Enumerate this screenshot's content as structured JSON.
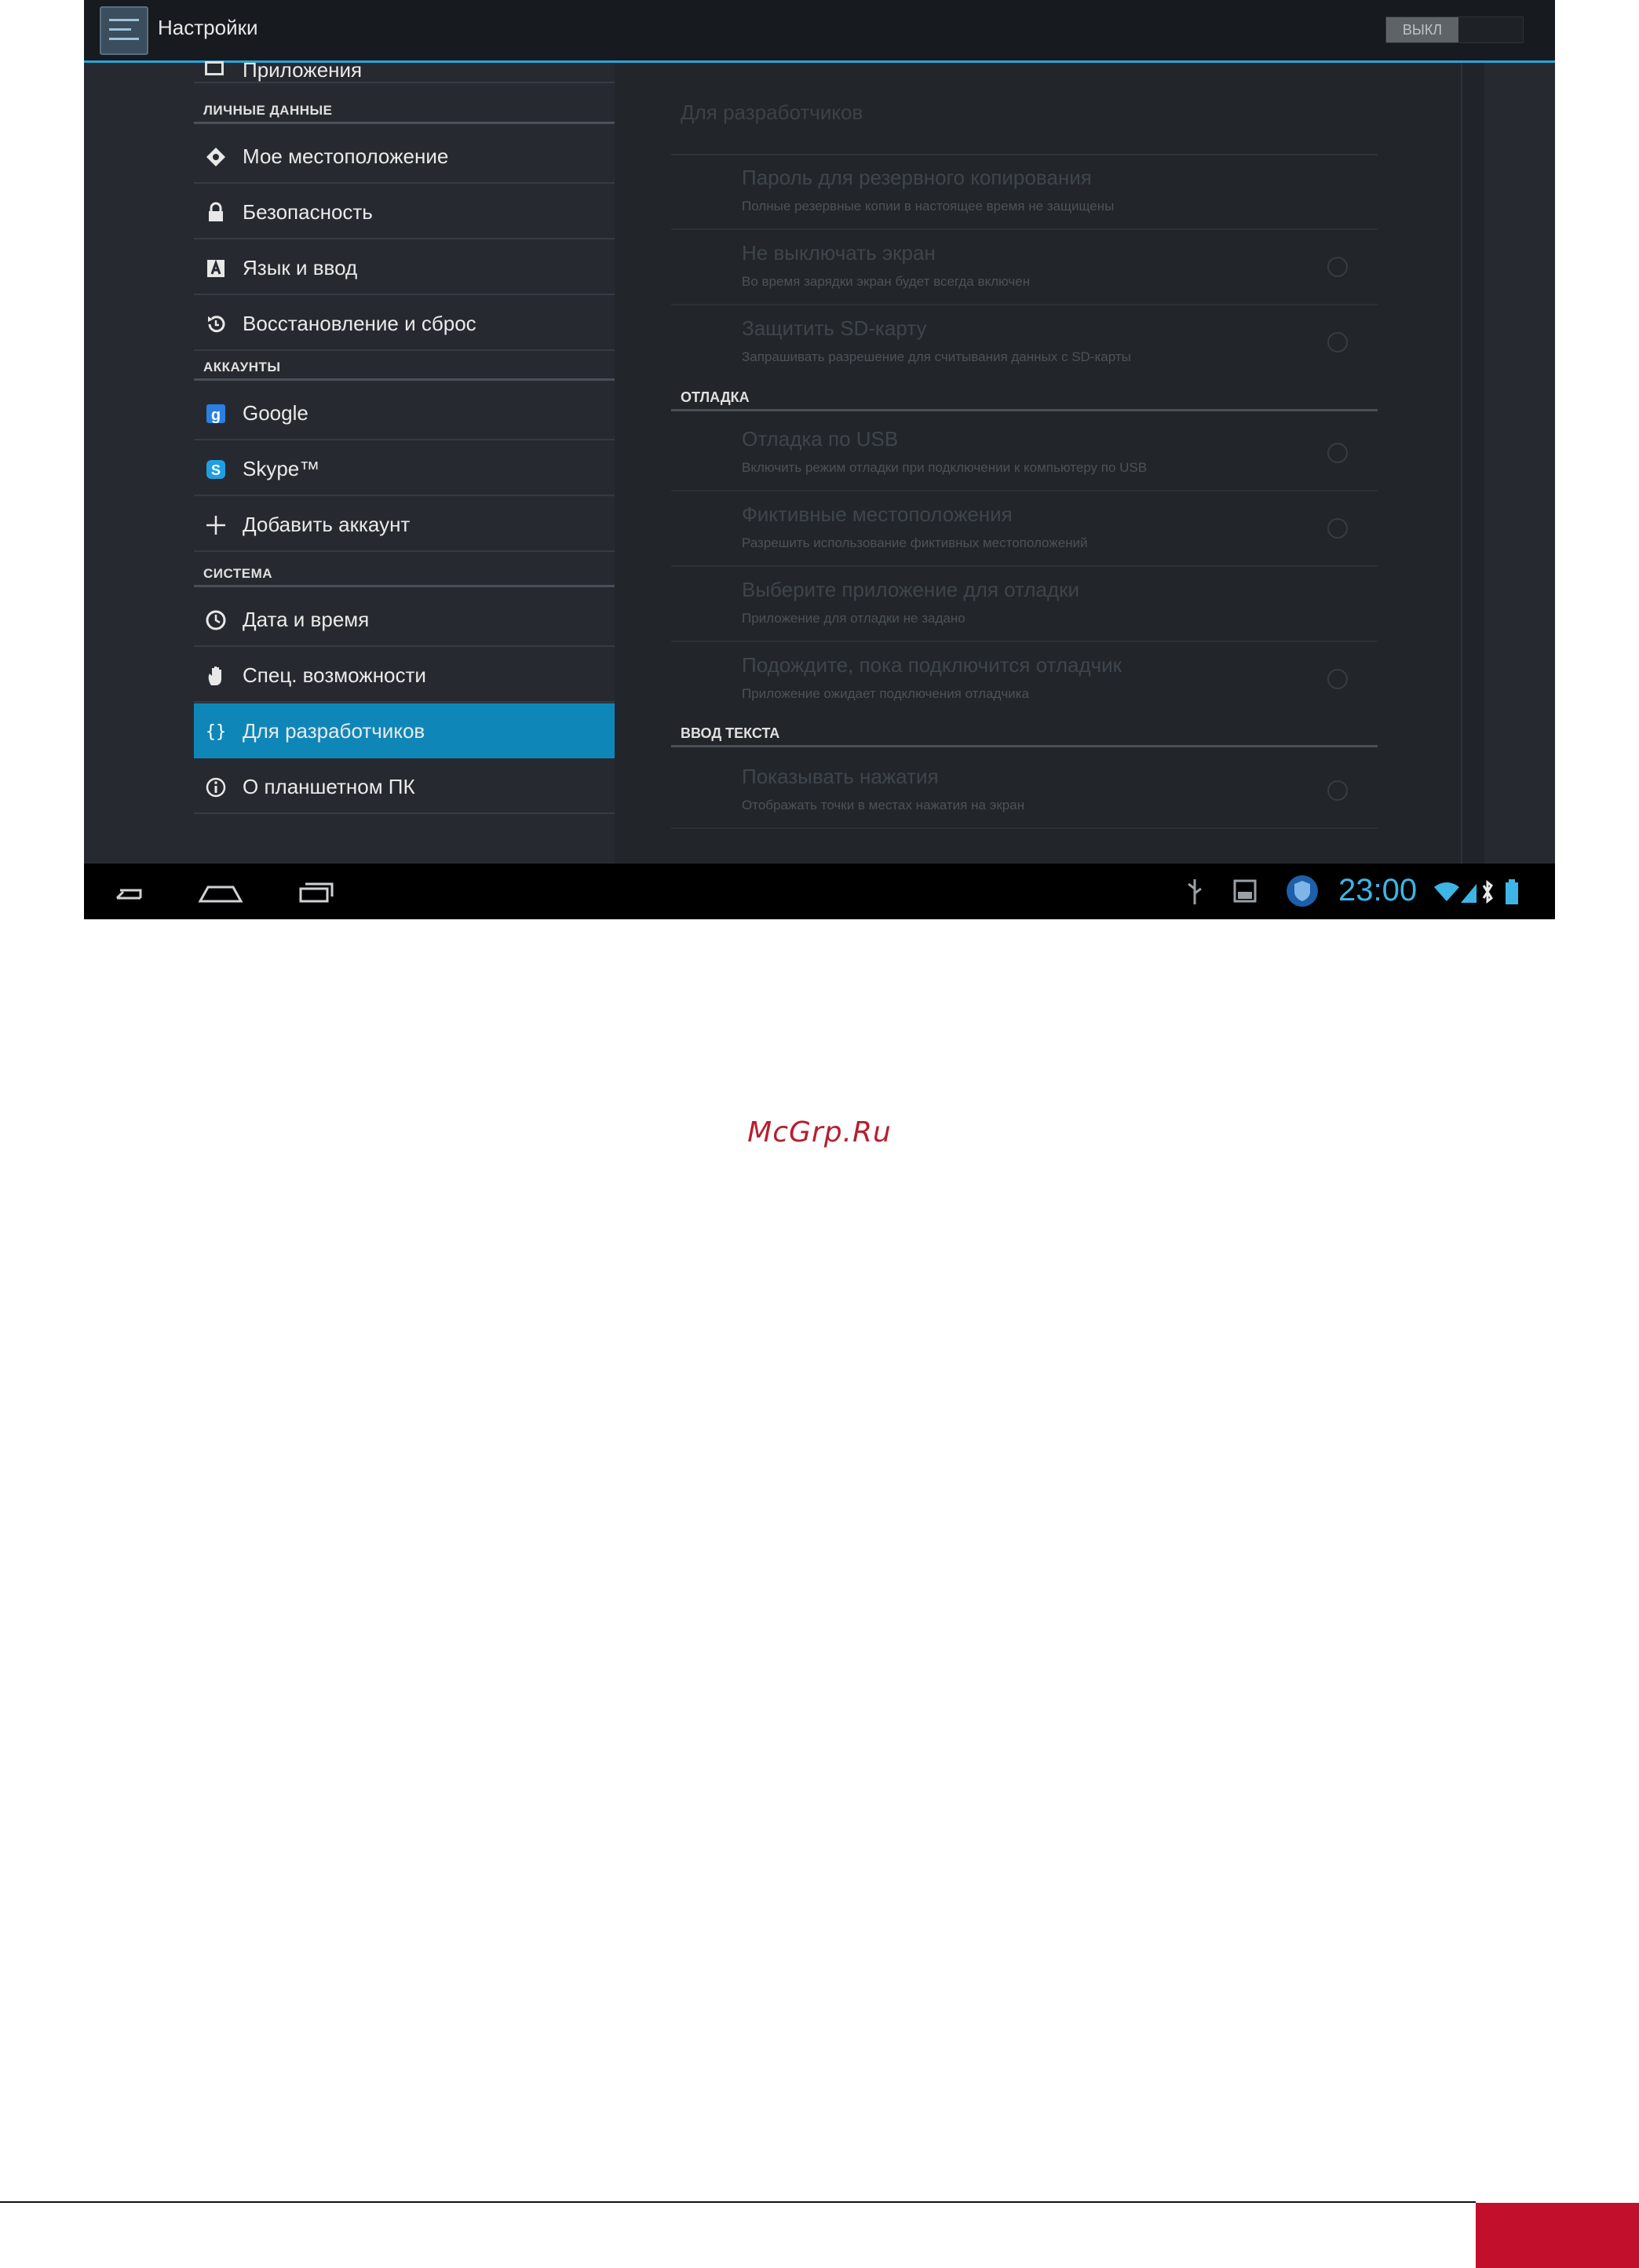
{
  "window": {
    "title": "Настройки",
    "toggle_label": "ВЫКЛ"
  },
  "sidebar": {
    "cut_item": "Приложения",
    "sections": [
      {
        "header": "ЛИЧНЫЕ ДАННЫЕ"
      },
      {
        "header": "АККАУНТЫ"
      },
      {
        "header": "СИСТЕМА"
      }
    ],
    "items": [
      {
        "label": "Мое местоположение",
        "icon": "location-icon"
      },
      {
        "label": "Безопасность",
        "icon": "lock-icon"
      },
      {
        "label": "Язык и ввод",
        "icon": "language-icon"
      },
      {
        "label": "Восстановление и сброс",
        "icon": "restore-icon"
      },
      {
        "label": "Google",
        "icon": "google-icon"
      },
      {
        "label": "Skype™",
        "icon": "skype-icon"
      },
      {
        "label": "Добавить аккаунт",
        "icon": "plus-icon"
      },
      {
        "label": "Дата и время",
        "icon": "clock-icon"
      },
      {
        "label": "Спец. возможности",
        "icon": "hand-icon"
      },
      {
        "label": "Для разработчиков",
        "icon": "braces-icon",
        "selected": true
      },
      {
        "label": "О планшетном ПК",
        "icon": "info-icon"
      }
    ]
  },
  "detail": {
    "title": "Для разработчиков",
    "prefs": [
      {
        "title": "Пароль для резервного копирования",
        "summary": "Полные резервные копии в настоящее время не защищены"
      },
      {
        "title": "Не выключать экран",
        "summary": "Во время зарядки экран будет всегда включен"
      },
      {
        "title": "Защитить SD-карту",
        "summary": "Запрашивать разрешение для считывания данных с SD-карты"
      }
    ],
    "section_debug": "ОТЛАДКА",
    "debug_prefs": [
      {
        "title": "Отладка по USB",
        "summary": "Включить режим отладки при подключении к компьютеру по USB"
      },
      {
        "title": "Фиктивные местоположения",
        "summary": "Разрешить использование фиктивных местоположений"
      },
      {
        "title": "Выберите приложение для отладки",
        "summary": "Приложение для отладки не задано"
      },
      {
        "title": "Подождите, пока подключится отладчик",
        "summary": "Приложение ожидает подключения отладчика"
      }
    ],
    "section_input": "ВВОД ТЕКСТА",
    "input_prefs": [
      {
        "title": "Показывать нажатия",
        "summary": "Отображать точки в местах нажатия на экран"
      }
    ]
  },
  "navbar": {
    "clock": "23:00",
    "accent": "#3db5e6"
  },
  "page": {
    "watermark": "McGrp.Ru",
    "footer_color": "#c2102c"
  }
}
